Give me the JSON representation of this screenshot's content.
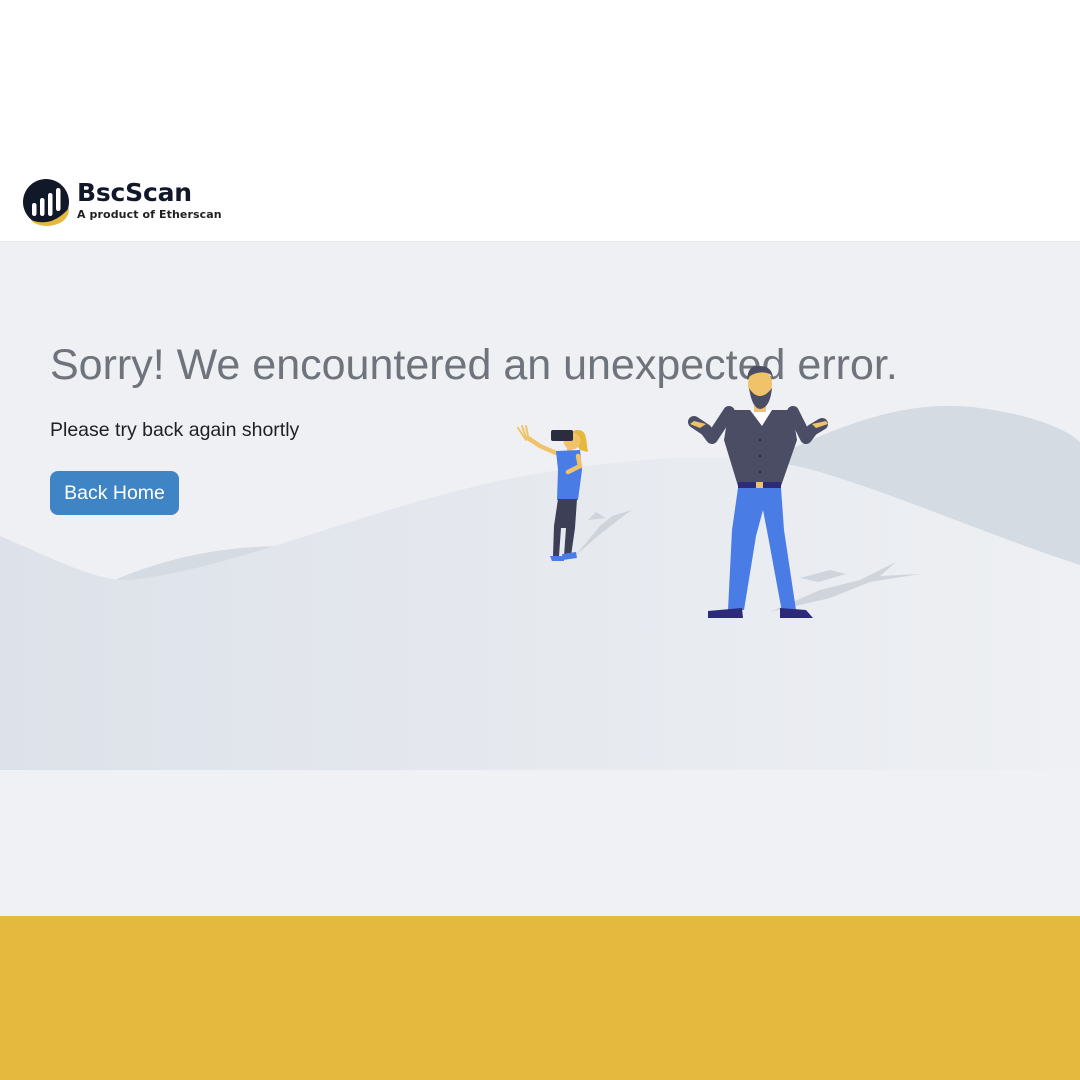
{
  "brand": {
    "name_part1": "Bsc",
    "name_part2": "Scan",
    "tagline": "A product of Etherscan",
    "colors": {
      "dark": "#111827",
      "gold": "#e5b93e"
    }
  },
  "error": {
    "headline": "Sorry! We encountered an unexpected error.",
    "message": "Please try back again shortly",
    "button_label": "Back Home",
    "button_color": "#3f84c5"
  },
  "illustration": {
    "icons": [
      "vr-girl-figure-icon",
      "shrugging-man-figure-icon"
    ]
  },
  "footer": {
    "color": "#e5b93e"
  }
}
